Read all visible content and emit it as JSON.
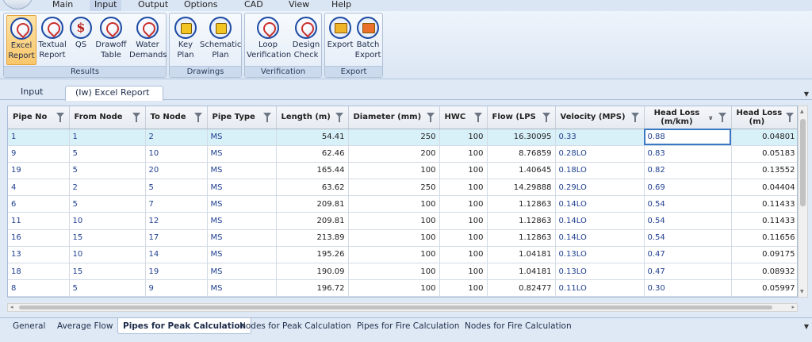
{
  "menu": [
    "Main",
    "Input",
    "Output",
    "Options",
    "CAD",
    "View",
    "Help"
  ],
  "ribbon": {
    "groups": [
      {
        "label": "Results",
        "buttons": [
          {
            "label": [
              "Excel",
              "Report"
            ],
            "icon": "acrobat-icon",
            "active": true
          },
          {
            "label": [
              "Textual",
              "Report"
            ],
            "icon": "acrobat-icon"
          },
          {
            "label": [
              "QS",
              ""
            ],
            "icon": "qs-dollar-icon"
          },
          {
            "label": [
              "Drawoff",
              "Table"
            ],
            "icon": "acrobat-icon"
          },
          {
            "label": [
              "Water",
              "Demands"
            ],
            "icon": "acrobat-icon"
          }
        ]
      },
      {
        "label": "Drawings",
        "buttons": [
          {
            "label": [
              "Key",
              "Plan"
            ],
            "icon": "dwg-icon"
          },
          {
            "label": [
              "Schematic",
              "Plan"
            ],
            "icon": "dwg-icon"
          }
        ]
      },
      {
        "label": "Verification",
        "buttons": [
          {
            "label": [
              "Loop",
              "Verification"
            ],
            "icon": "acrobat-icon"
          },
          {
            "label": [
              "Design",
              "Check"
            ],
            "icon": "acrobat-icon"
          }
        ]
      },
      {
        "label": "Export",
        "buttons": [
          {
            "label": [
              "Export",
              ""
            ],
            "icon": "export-icon"
          },
          {
            "label": [
              "Batch",
              "Export"
            ],
            "icon": "batch-export-icon"
          }
        ]
      }
    ]
  },
  "doc_tabs": [
    {
      "label": "Input",
      "active": false
    },
    {
      "label": "(Iw) Excel Report",
      "active": true
    }
  ],
  "grid": {
    "columns": [
      {
        "label": [
          "Pipe No"
        ],
        "type": "txt"
      },
      {
        "label": [
          "From Node"
        ],
        "type": "txt"
      },
      {
        "label": [
          "To Node"
        ],
        "type": "txt"
      },
      {
        "label": [
          "Pipe Type"
        ],
        "type": "txt"
      },
      {
        "label": [
          "Length (m)"
        ],
        "type": "num"
      },
      {
        "label": [
          "Diameter (mm)"
        ],
        "type": "num"
      },
      {
        "label": [
          "HWC"
        ],
        "type": "num"
      },
      {
        "label": [
          "Flow (LPS"
        ],
        "type": "num"
      },
      {
        "label": [
          "Velocity (MPS)"
        ],
        "type": "txt"
      },
      {
        "label": [
          "Head Loss",
          "(m/km)"
        ],
        "type": "txt",
        "sorted": true
      },
      {
        "label": [
          "Head Loss",
          "(m)"
        ],
        "type": "num"
      }
    ],
    "rows": [
      [
        "1",
        "1",
        "2",
        "MS",
        "54.41",
        "250",
        "100",
        "16.30095",
        "0.33",
        "0.88",
        "0.04801"
      ],
      [
        "9",
        "5",
        "10",
        "MS",
        "62.46",
        "200",
        "100",
        "8.76859",
        "0.28LO",
        "0.83",
        "0.05183"
      ],
      [
        "19",
        "5",
        "20",
        "MS",
        "165.44",
        "100",
        "100",
        "1.40645",
        "0.18LO",
        "0.82",
        "0.13552"
      ],
      [
        "4",
        "2",
        "5",
        "MS",
        "63.62",
        "250",
        "100",
        "14.29888",
        "0.29LO",
        "0.69",
        "0.04404"
      ],
      [
        "6",
        "5",
        "7",
        "MS",
        "209.81",
        "100",
        "100",
        "1.12863",
        "0.14LO",
        "0.54",
        "0.11433"
      ],
      [
        "11",
        "10",
        "12",
        "MS",
        "209.81",
        "100",
        "100",
        "1.12863",
        "0.14LO",
        "0.54",
        "0.11433"
      ],
      [
        "16",
        "15",
        "17",
        "MS",
        "213.89",
        "100",
        "100",
        "1.12863",
        "0.14LO",
        "0.54",
        "0.11656"
      ],
      [
        "13",
        "10",
        "14",
        "MS",
        "195.26",
        "100",
        "100",
        "1.04181",
        "0.13LO",
        "0.47",
        "0.09175"
      ],
      [
        "18",
        "15",
        "19",
        "MS",
        "190.09",
        "100",
        "100",
        "1.04181",
        "0.13LO",
        "0.47",
        "0.08932"
      ],
      [
        "8",
        "5",
        "9",
        "MS",
        "196.72",
        "100",
        "100",
        "0.82477",
        "0.11LO",
        "0.30",
        "0.05997"
      ]
    ],
    "selected_row": 0
  },
  "sheet_tabs": [
    {
      "label": "General",
      "active": false
    },
    {
      "label": "Average Flow",
      "active": false
    },
    {
      "label": "Pipes for Peak Calculation",
      "active": true
    },
    {
      "label": "Nodes for Peak Calculation",
      "active": false
    },
    {
      "label": "Pipes for Fire Calculation",
      "active": false
    },
    {
      "label": "Nodes for Fire Calculation",
      "active": false
    }
  ]
}
